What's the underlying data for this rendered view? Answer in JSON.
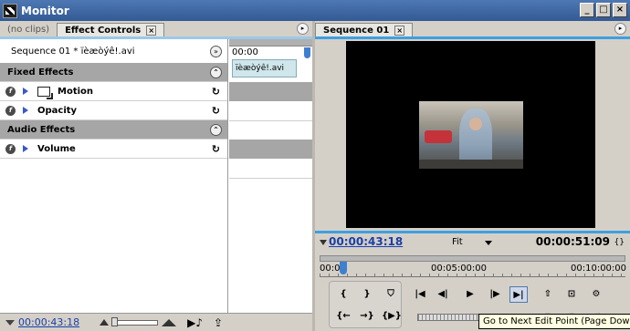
{
  "window": {
    "title": "Monitor"
  },
  "left": {
    "tabs": [
      {
        "label": "(no clips)"
      },
      {
        "label": "Effect Controls"
      }
    ],
    "clip_label": "Sequence 01 * ïèæòýê!.avi",
    "sections": [
      {
        "label": "Fixed Effects"
      },
      {
        "label": "Audio Effects"
      }
    ],
    "effects": [
      {
        "label": "Motion"
      },
      {
        "label": "Opacity"
      },
      {
        "label": "Volume"
      }
    ],
    "timeline": {
      "time": "00:00",
      "clip_name": "ïèæòýê!.avi"
    },
    "footer": {
      "time": "00:00:43:18"
    }
  },
  "right": {
    "tab": "Sequence 01",
    "current_time": "00:00:43:18",
    "fit_label": "Fit",
    "duration": "00:00:51:09",
    "ruler": {
      "labels": [
        "00:00",
        "00:05:00:00",
        "00:10:00:00"
      ]
    },
    "tooltip": "Go to Next Edit Point (Page Down)"
  },
  "icons": {
    "close": "×",
    "menu": "▸",
    "reset": "↻",
    "forward": "»",
    "collapse": "⌃"
  }
}
